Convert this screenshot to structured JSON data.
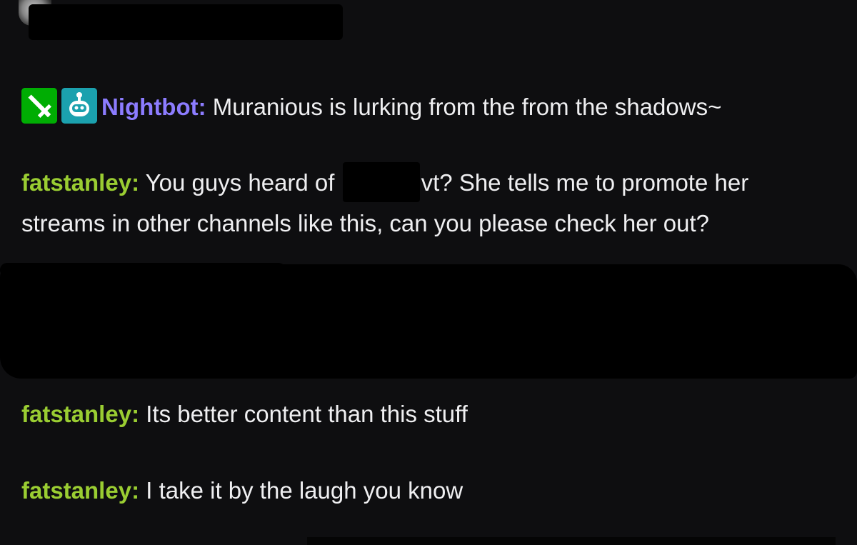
{
  "messages": [
    {
      "username": "Nightbot",
      "separator": ":",
      "text": " Muranious is lurking from the from the shadows~",
      "badges": [
        "moderator-sword-icon",
        "bot-icon"
      ],
      "username_color": "#8c7cff"
    },
    {
      "username": "fatstanley",
      "separator": ":",
      "text_before": " You guys heard of ",
      "text_after": "vt? She tells me to promote her",
      "text_line2": "streams in other channels like this, can you please check her out?",
      "username_color": "#9acd32"
    },
    {
      "username": "fatstanley",
      "separator": ":",
      "text": " Its better content than this stuff",
      "username_color": "#9acd32"
    },
    {
      "username": "fatstanley",
      "separator": ":",
      "text": " I take it by the laugh you know",
      "username_color": "#9acd32"
    }
  ],
  "colors": {
    "background": "#0e0e10",
    "moderator_badge": "#00ad03",
    "bot_badge": "#1ba1ae",
    "text": "#efeff1"
  }
}
